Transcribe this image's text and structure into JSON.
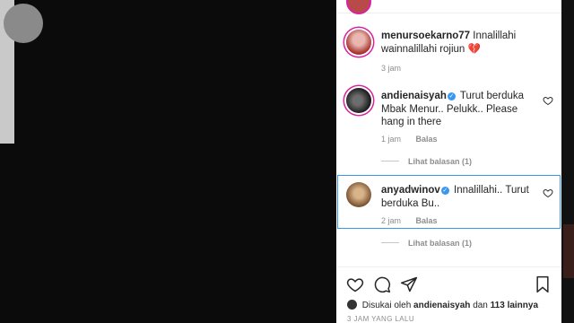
{
  "comments": [
    {
      "username": "menursoekarno77",
      "text": "Innalillahi wainnalillahi rojiun 💔",
      "time": "3 jam",
      "verified": false
    },
    {
      "username": "andienaisyah",
      "text": "Turut berduka Mbak Menur.. Pelukk.. Please hang in there",
      "time": "1 jam",
      "reply_label": "Balas",
      "view_replies": "Lihat balasan (1)",
      "verified": true
    },
    {
      "username": "anyadwinov",
      "text": "Innalillahi.. Turut berduka Bu..",
      "time": "2 jam",
      "reply_label": "Balas",
      "view_replies": "Lihat balasan (1)",
      "verified": true
    }
  ],
  "likes": {
    "prefix": "Disukai oleh",
    "user": "andienaisyah",
    "middle": "dan",
    "count": "113 lainnya"
  },
  "post_timestamp": "3 JAM YANG LALU",
  "colors": {
    "verified": "#3897f0",
    "story_ring": "#d6249f",
    "highlight": "#3897f0",
    "muted": "#8e8e8e"
  }
}
